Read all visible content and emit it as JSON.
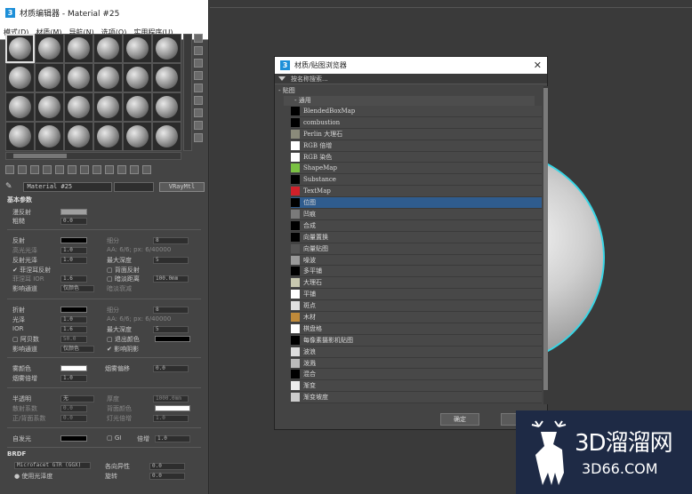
{
  "material_editor": {
    "title": "材质编辑器 - Material #25",
    "menus": [
      "模式(D)",
      "材质(M)",
      "导航(N)",
      "选项(O)",
      "实用程序(U)"
    ],
    "material_name": "Material #25",
    "material_type": "VRayMtl",
    "section_basic": "基本参数",
    "section_brdf": "BRDF",
    "diffuse": {
      "label": "漫反射",
      "color": "#a0a0a0"
    },
    "roughness": {
      "label": "粗糙",
      "value": "0.0"
    },
    "reflect": {
      "label": "反射",
      "color": "#000000",
      "subdivs_label": "细分",
      "subdivs": "8",
      "hilight_label": "高光光泽",
      "hilight": "1.0",
      "aa_text": "AA: 6/6; px: 6/40000",
      "gloss_label": "反射光泽",
      "gloss": "1.0",
      "maxdepth_label": "最大深度",
      "maxdepth": "5",
      "fresnel_label": "菲涅耳反射",
      "back_label": "背面反射",
      "fresnel_ior_label": "菲涅耳 IOR",
      "fresnel_ior": "1.6",
      "dim_label": "暗淡距离",
      "dim_value": "100.0mm",
      "affect_label": "影响通道",
      "affect_value": "仅颜色",
      "dim_falloff_label": "暗淡衰减"
    },
    "refract": {
      "label": "折射",
      "color": "#000000",
      "subdivs_label": "细分",
      "subdivs": "8",
      "gloss_label": "光泽",
      "gloss": "1.0",
      "aa_text": "AA: 6/6; px: 6/40000",
      "ior_label": "IOR",
      "ior": "1.6",
      "maxdepth_label": "最大深度",
      "maxdepth": "5",
      "abbe_label": "阿贝数",
      "abbe": "50.0",
      "exit_label": "退出颜色",
      "affect_label": "影响通道",
      "affect_value": "仅颜色",
      "shadow_label": "影响阴影"
    },
    "fog": {
      "label": "雾颜色",
      "color": "#ffffff",
      "bias_label": "烟雾偏移",
      "bias": "0.0",
      "mult_label": "烟雾倍增",
      "mult": "1.0"
    },
    "translucency": {
      "label": "半透明",
      "value": "无",
      "thickness_label": "厚度",
      "thickness": "1000.0mm",
      "scatter_label": "散射系数",
      "scatter": "0.0",
      "back_label": "背面颜色",
      "fwdback_label": "正/背面系数",
      "fwdback": "0.0",
      "light_label": "灯光倍增",
      "light": "1.0"
    },
    "selfillum": {
      "label": "自发光",
      "gi_label": "GI",
      "mult_label": "倍增",
      "mult": "1.0"
    },
    "brdf": {
      "type": "Microfacet GTR (GGX)",
      "aniso_label": "各向异性",
      "aniso": "0.0",
      "use_gloss_label": "使用光泽度",
      "rotation_label": "旋转",
      "rotation": "0.0"
    }
  },
  "browser": {
    "title": "材质/贴图浏览器",
    "search_placeholder": "按名称搜索...",
    "group_maps": "- 贴图",
    "group_general": "- 通用",
    "items": [
      {
        "label": "BlendedBoxMap",
        "icon": "#000000"
      },
      {
        "label": "combustion",
        "icon": "#000000"
      },
      {
        "label": "Perlin 大理石",
        "icon": "#8a8a7a"
      },
      {
        "label": "RGB 倍增",
        "icon": "#ffffff"
      },
      {
        "label": "RGB 染色",
        "icon": "#ffffff"
      },
      {
        "label": "ShapeMap",
        "icon": "#7ac143"
      },
      {
        "label": "Substance",
        "icon": "#000000"
      },
      {
        "label": "TextMap",
        "icon": "#d0202a"
      },
      {
        "label": "位图",
        "icon": "#000000"
      },
      {
        "label": "凹痕",
        "icon": "#7a7a7a"
      },
      {
        "label": "合成",
        "icon": "#000000"
      },
      {
        "label": "向量置换",
        "icon": "#000000"
      },
      {
        "label": "向量贴图",
        "icon": "#555555"
      },
      {
        "label": "噪波",
        "icon": "#9a9a9a"
      },
      {
        "label": "多平铺",
        "icon": "#000000"
      },
      {
        "label": "大理石",
        "icon": "#c8c8b0"
      },
      {
        "label": "平铺",
        "icon": "#ffffff"
      },
      {
        "label": "斑点",
        "icon": "#e0e0e0"
      },
      {
        "label": "木材",
        "icon": "#c08a3a"
      },
      {
        "label": "棋盘格",
        "icon": "#ffffff"
      },
      {
        "label": "每像素摄影机贴图",
        "icon": "#000000"
      },
      {
        "label": "波浪",
        "icon": "#dddddd"
      },
      {
        "label": "泼溅",
        "icon": "#bbbbbb"
      },
      {
        "label": "混合",
        "icon": "#000000"
      },
      {
        "label": "渐变",
        "icon": "#eeeeee"
      },
      {
        "label": "渐变坡度",
        "icon": "#cccccc"
      }
    ],
    "selected_index": 8,
    "ok_label": "确定",
    "cancel_label": "取"
  },
  "watermark": {
    "brand": "3D溜溜网",
    "url": "3D66.COM"
  }
}
